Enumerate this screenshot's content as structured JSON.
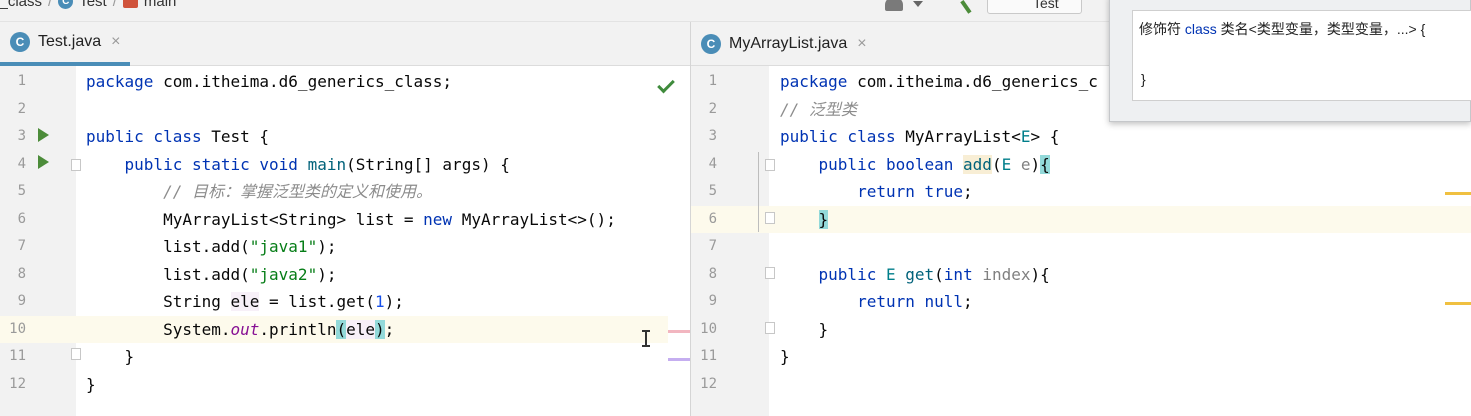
{
  "breadcrumb": {
    "items": [
      "s_class",
      "Test",
      "main"
    ]
  },
  "toolbar": {
    "run_config": "Test"
  },
  "left_editor": {
    "tab": {
      "label": "Test.java",
      "close": "×"
    },
    "lines": [
      {
        "n": "1",
        "html": "<span class=\"kw\">package</span> com.itheima.d6_generics_class;"
      },
      {
        "n": "2",
        "html": ""
      },
      {
        "n": "3",
        "html": "<span class=\"kw\">public class</span> Test {"
      },
      {
        "n": "4",
        "html": "    <span class=\"kw\">public static void</span> <span class=\"method\">main</span>(String[] args) {"
      },
      {
        "n": "5",
        "html": "        <span class=\"cm\">// 目标：掌握泛型类的定义和使用。</span>"
      },
      {
        "n": "6",
        "html": "        MyArrayList&lt;String&gt; list = <span class=\"kw\">new</span> MyArrayList&lt;&gt;();"
      },
      {
        "n": "7",
        "html": "        list.add(<span class=\"str\">\"java1\"</span>);"
      },
      {
        "n": "8",
        "html": "        list.add(<span class=\"str\">\"java2\"</span>);"
      },
      {
        "n": "9",
        "html": "        String <span class=\"var-hl\">ele</span> = list.get(<span class=\"num\">1</span>);"
      },
      {
        "n": "10",
        "html": "        System.<span class=\"static-call\">out</span>.println<span class=\"brace-hl\">(</span><span class=\"var-hl\">ele</span><span class=\"brace-hl\">)</span>;"
      },
      {
        "n": "11",
        "html": "    }"
      },
      {
        "n": "12",
        "html": "}"
      }
    ]
  },
  "right_editor": {
    "tab": {
      "label": "MyArrayList.java",
      "close": "×"
    },
    "lines": [
      {
        "n": "1",
        "html": "<span class=\"kw\">package</span> com.itheima.d6_generics_c"
      },
      {
        "n": "2",
        "html": "<span class=\"cm\">// 泛型类</span>"
      },
      {
        "n": "3",
        "html": "<span class=\"kw\">public class</span> MyArrayList&lt;<span class=\"tp\">E</span>&gt; {"
      },
      {
        "n": "4",
        "html": "    <span class=\"kw\">public boolean</span> <span class=\"unused-hl method\">add</span>(<span class=\"tp\">E</span> <span class=\"gray\">e</span>)<span class=\"brace-hl\">{</span>"
      },
      {
        "n": "5",
        "html": "        <span class=\"kw\">return true</span>;"
      },
      {
        "n": "6",
        "html": "    <span class=\"brace-hl\">}</span>"
      },
      {
        "n": "7",
        "html": ""
      },
      {
        "n": "8",
        "html": "    <span class=\"kw\">public</span> <span class=\"tp\">E</span> <span class=\"method\">get</span>(<span class=\"kw\">int</span> <span class=\"gray\">index</span>){"
      },
      {
        "n": "9",
        "html": "        <span class=\"kw\">return null</span>;"
      },
      {
        "n": "10",
        "html": "    }"
      },
      {
        "n": "11",
        "html": "}"
      },
      {
        "n": "12",
        "html": ""
      }
    ]
  },
  "doc_popup": {
    "prefix": "修饰符 ",
    "keyword": "class",
    "suffix": " 类名<类型变量，类型变量，...> {",
    "close": "}"
  },
  "colors": {
    "keyword": "#0033b3",
    "string": "#067d17",
    "comment": "#8c8c8c",
    "run_icon": "#4c8c3a",
    "tab_underline": "#4a8db7"
  }
}
